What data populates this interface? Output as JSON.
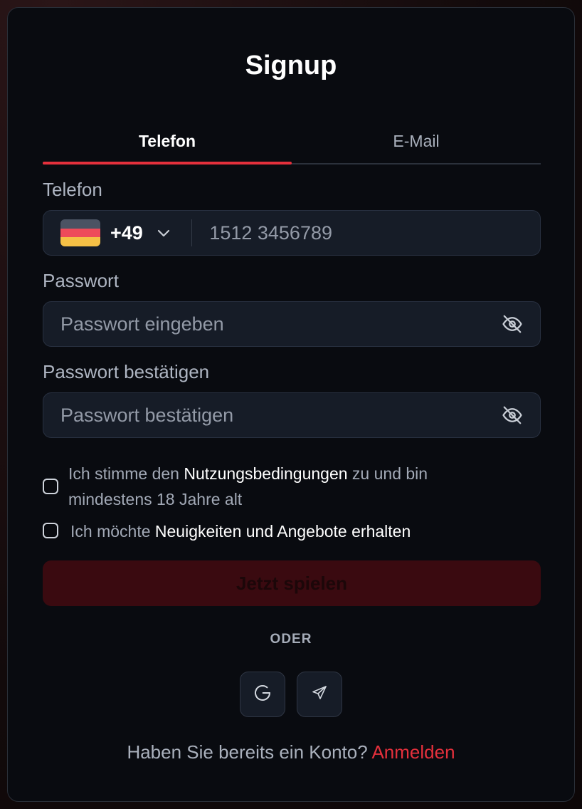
{
  "title": "Signup",
  "tabs": [
    {
      "label": "Telefon",
      "active": true
    },
    {
      "label": "E-Mail",
      "active": false
    }
  ],
  "phone": {
    "label": "Telefon",
    "country_code": "+49",
    "flag": "germany-flag",
    "placeholder": "1512 3456789",
    "value": ""
  },
  "password": {
    "label": "Passwort",
    "placeholder": "Passwort eingeben",
    "value": ""
  },
  "confirm_password": {
    "label": "Passwort bestätigen",
    "placeholder": "Passwort bestätigen",
    "value": ""
  },
  "terms": {
    "checked": false,
    "prefix": "Ich stimme den ",
    "link": "Nutzungsbedingungen",
    "suffix_line1": " zu und bin",
    "line2": "mindestens 18 Jahre alt"
  },
  "newsletter": {
    "checked": false,
    "prefix": "Ich möchte ",
    "highlight": "Neuigkeiten und Angebote erhalten"
  },
  "submit_label": "Jetzt spielen",
  "divider_label": "ODER",
  "social": [
    {
      "name": "google-icon"
    },
    {
      "name": "telegram-icon"
    }
  ],
  "footer": {
    "text": "Haben Sie bereits ein Konto? ",
    "login_link": "Anmelden"
  },
  "colors": {
    "accent": "#e5303c",
    "card_bg": "#090b10",
    "input_bg": "#161c27",
    "button_disabled_bg": "#3a0a10"
  }
}
